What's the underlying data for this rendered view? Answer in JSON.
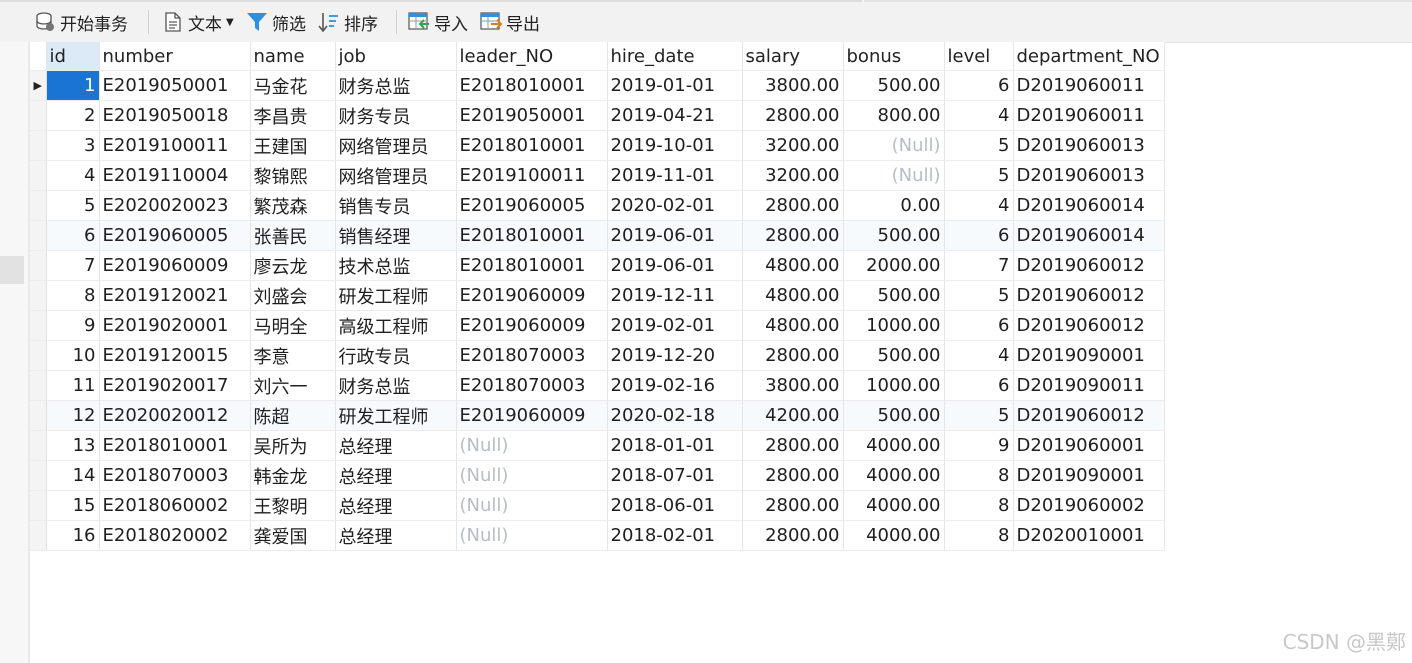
{
  "toolbar": {
    "begin_transaction": "开始事务",
    "text": "文本",
    "filter": "筛选",
    "sort": "排序",
    "import": "导入",
    "export": "导出"
  },
  "columns": [
    "id",
    "number",
    "name",
    "job",
    "leader_NO",
    "hire_date",
    "salary",
    "bonus",
    "level",
    "department_NO"
  ],
  "rows": [
    {
      "id": "1",
      "number": "E2019050001",
      "name": "马金花",
      "job": "财务总监",
      "leader_NO": "E2018010001",
      "hire_date": "2019-01-01",
      "salary": "3800.00",
      "bonus": "500.00",
      "level": "6",
      "department_NO": "D2019060011"
    },
    {
      "id": "2",
      "number": "E2019050018",
      "name": "李昌贵",
      "job": "财务专员",
      "leader_NO": "E2019050001",
      "hire_date": "2019-04-21",
      "salary": "2800.00",
      "bonus": "800.00",
      "level": "4",
      "department_NO": "D2019060011"
    },
    {
      "id": "3",
      "number": "E2019100011",
      "name": "王建国",
      "job": "网络管理员",
      "leader_NO": "E2018010001",
      "hire_date": "2019-10-01",
      "salary": "3200.00",
      "bonus": "(Null)",
      "level": "5",
      "department_NO": "D2019060013"
    },
    {
      "id": "4",
      "number": "E2019110004",
      "name": "黎锦熙",
      "job": "网络管理员",
      "leader_NO": "E2019100011",
      "hire_date": "2019-11-01",
      "salary": "3200.00",
      "bonus": "(Null)",
      "level": "5",
      "department_NO": "D2019060013"
    },
    {
      "id": "5",
      "number": "E2020020023",
      "name": "繁茂森",
      "job": "销售专员",
      "leader_NO": "E2019060005",
      "hire_date": "2020-02-01",
      "salary": "2800.00",
      "bonus": "0.00",
      "level": "4",
      "department_NO": "D2019060014"
    },
    {
      "id": "6",
      "number": "E2019060005",
      "name": "张善民",
      "job": "销售经理",
      "leader_NO": "E2018010001",
      "hire_date": "2019-06-01",
      "salary": "2800.00",
      "bonus": "500.00",
      "level": "6",
      "department_NO": "D2019060014"
    },
    {
      "id": "7",
      "number": "E2019060009",
      "name": "廖云龙",
      "job": "技术总监",
      "leader_NO": "E2018010001",
      "hire_date": "2019-06-01",
      "salary": "4800.00",
      "bonus": "2000.00",
      "level": "7",
      "department_NO": "D2019060012"
    },
    {
      "id": "8",
      "number": "E2019120021",
      "name": "刘盛会",
      "job": "研发工程师",
      "leader_NO": "E2019060009",
      "hire_date": "2019-12-11",
      "salary": "4800.00",
      "bonus": "500.00",
      "level": "5",
      "department_NO": "D2019060012"
    },
    {
      "id": "9",
      "number": "E2019020001",
      "name": "马明全",
      "job": "高级工程师",
      "leader_NO": "E2019060009",
      "hire_date": "2019-02-01",
      "salary": "4800.00",
      "bonus": "1000.00",
      "level": "6",
      "department_NO": "D2019060012"
    },
    {
      "id": "10",
      "number": "E2019120015",
      "name": "李意",
      "job": "行政专员",
      "leader_NO": "E2018070003",
      "hire_date": "2019-12-20",
      "salary": "2800.00",
      "bonus": "500.00",
      "level": "4",
      "department_NO": "D2019090001"
    },
    {
      "id": "11",
      "number": "E2019020017",
      "name": "刘六一",
      "job": "财务总监",
      "leader_NO": "E2018070003",
      "hire_date": "2019-02-16",
      "salary": "3800.00",
      "bonus": "1000.00",
      "level": "6",
      "department_NO": "D2019090011"
    },
    {
      "id": "12",
      "number": "E2020020012",
      "name": "陈超",
      "job": "研发工程师",
      "leader_NO": "E2019060009",
      "hire_date": "2020-02-18",
      "salary": "4200.00",
      "bonus": "500.00",
      "level": "5",
      "department_NO": "D2019060012"
    },
    {
      "id": "13",
      "number": "E2018010001",
      "name": "吴所为",
      "job": "总经理",
      "leader_NO": "(Null)",
      "hire_date": "2018-01-01",
      "salary": "2800.00",
      "bonus": "4000.00",
      "level": "9",
      "department_NO": "D2019060001"
    },
    {
      "id": "14",
      "number": "E2018070003",
      "name": "韩金龙",
      "job": "总经理",
      "leader_NO": "(Null)",
      "hire_date": "2018-07-01",
      "salary": "2800.00",
      "bonus": "4000.00",
      "level": "8",
      "department_NO": "D2019090001"
    },
    {
      "id": "15",
      "number": "E2018060002",
      "name": "王黎明",
      "job": "总经理",
      "leader_NO": "(Null)",
      "hire_date": "2018-06-01",
      "salary": "2800.00",
      "bonus": "4000.00",
      "level": "8",
      "department_NO": "D2019060002"
    },
    {
      "id": "16",
      "number": "E2018020002",
      "name": "龚爱国",
      "job": "总经理",
      "leader_NO": "(Null)",
      "hire_date": "2018-02-01",
      "salary": "2800.00",
      "bonus": "4000.00",
      "level": "8",
      "department_NO": "D2020010001"
    }
  ],
  "selected_row_id": "1",
  "alt_row_ids": [
    "6",
    "12"
  ],
  "row_marker": "▶",
  "watermark": "CSDN @黑鄚",
  "colors": {
    "selection": "#1a74d4",
    "null_text": "#b7bdc8",
    "header_active": "#dce9f7",
    "toolbar_bg": "#f2f2f2"
  }
}
